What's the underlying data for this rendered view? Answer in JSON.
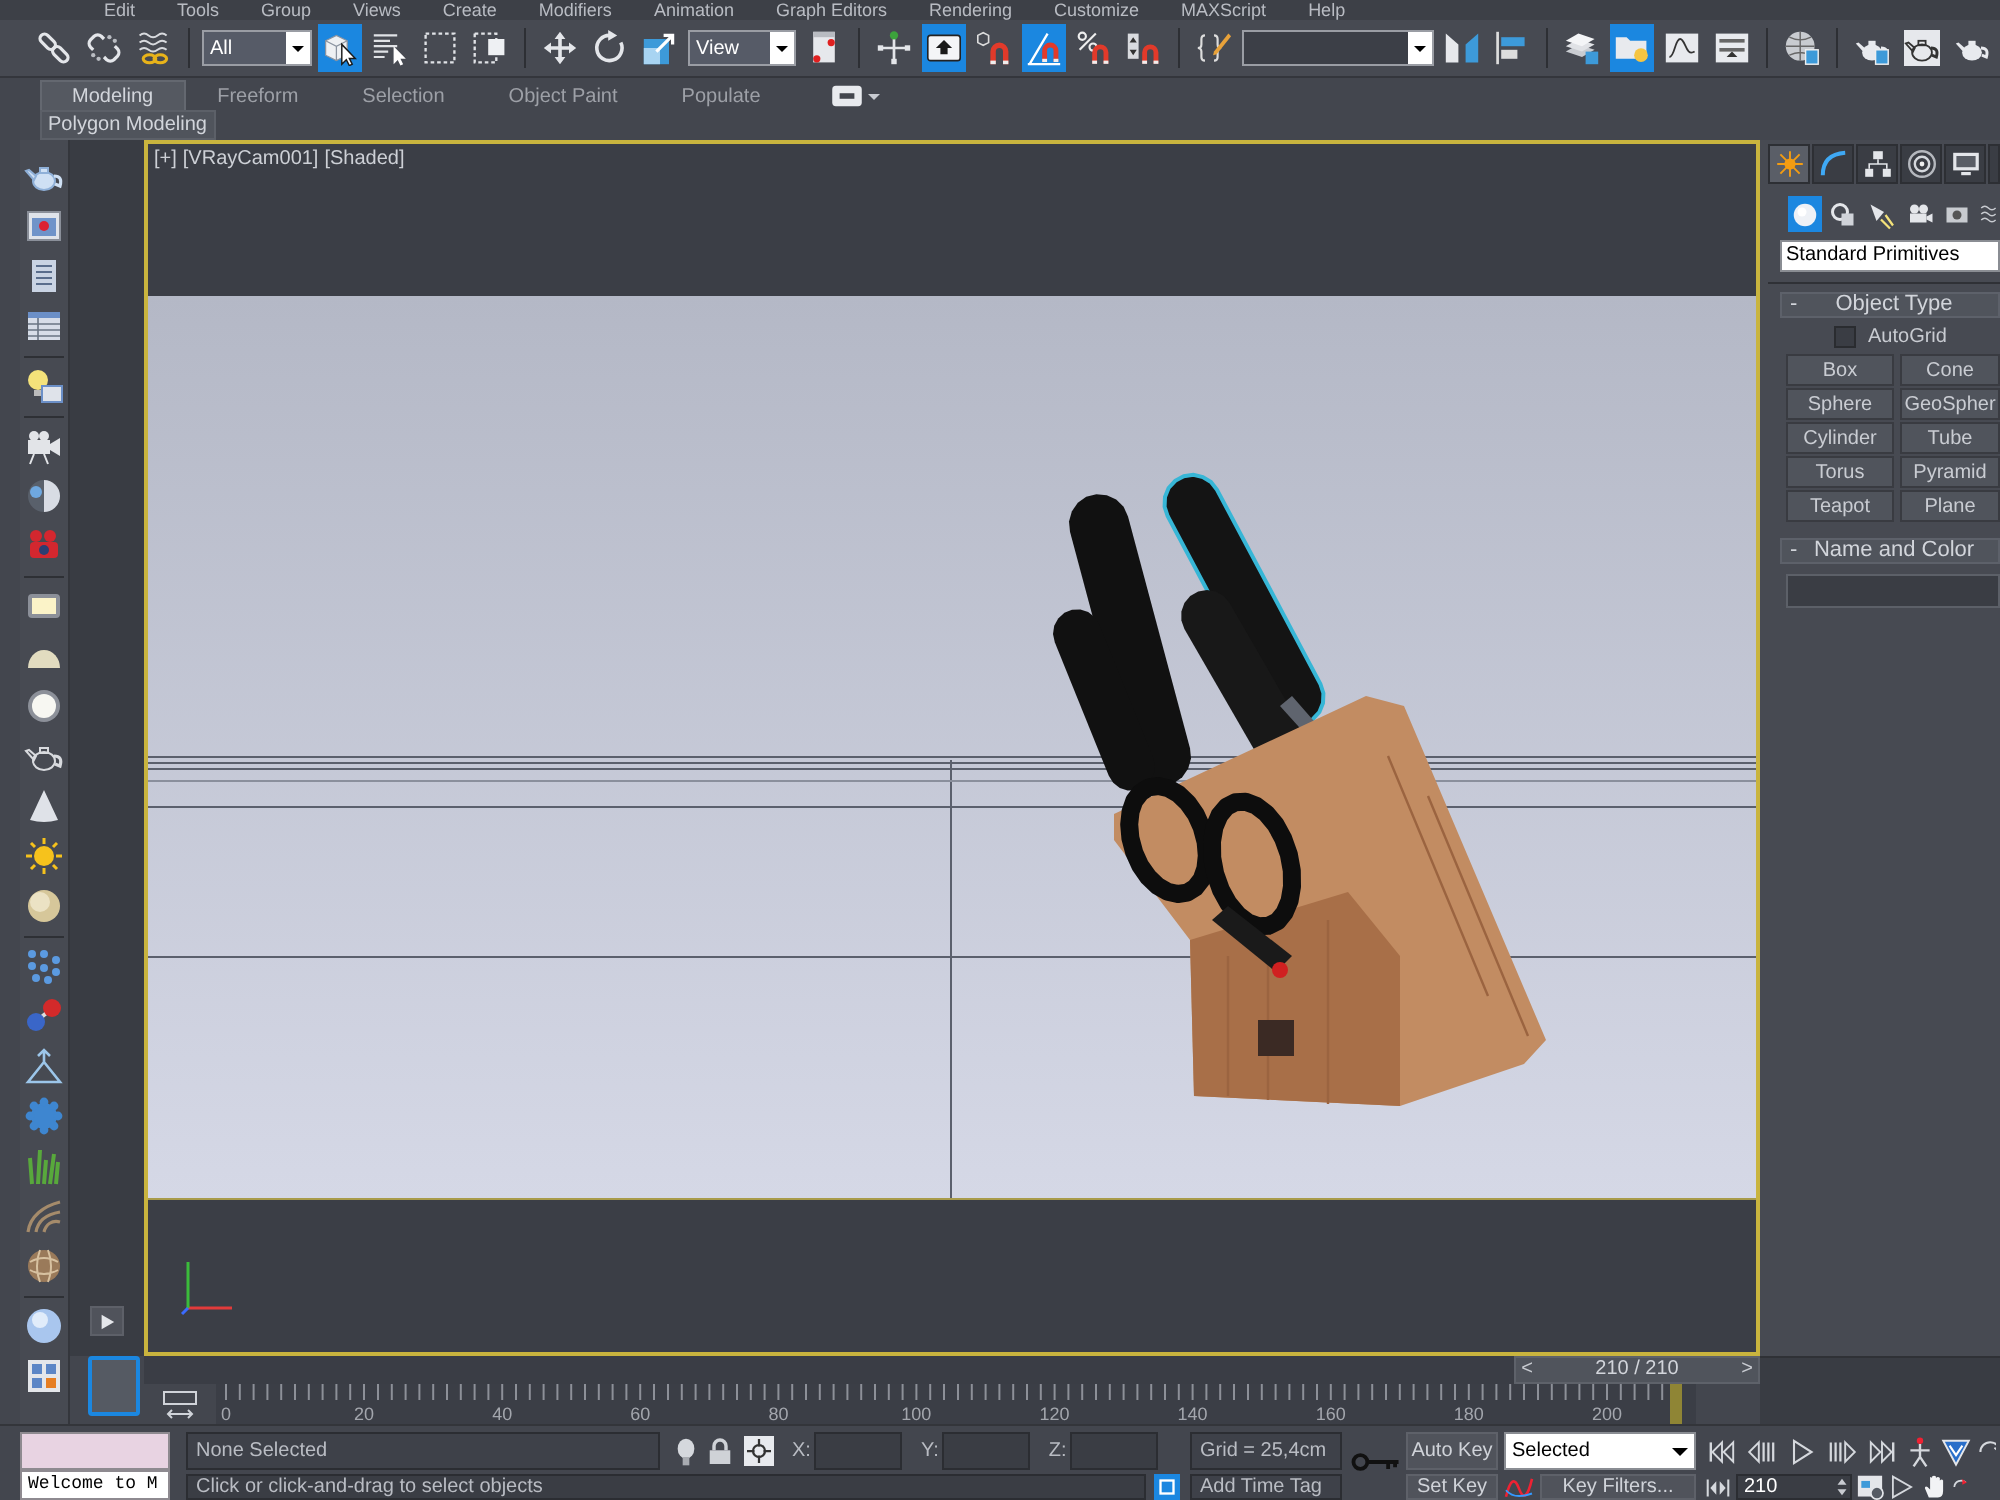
{
  "menu_bar": {
    "items": [
      "Edit",
      "Tools",
      "Group",
      "Views",
      "Create",
      "Modifiers",
      "Animation",
      "Graph Editors",
      "Rendering",
      "Customize",
      "MAXScript",
      "Help"
    ]
  },
  "main_toolbar": {
    "groups": [
      [
        {
          "kind": "tool",
          "pressed": false
        },
        {
          "kind": "tool",
          "pressed": false
        },
        {
          "kind": "tool",
          "pressed": false
        }
      ],
      [
        {
          "kind": "dropdown",
          "value": "All"
        },
        {
          "kind": "tool",
          "pressed": true
        },
        {
          "kind": "tool",
          "pressed": false
        },
        {
          "kind": "tool",
          "pressed": false
        },
        {
          "kind": "tool",
          "pressed": false
        }
      ],
      [
        {
          "kind": "tool",
          "pressed": false
        },
        {
          "kind": "tool",
          "pressed": false
        },
        {
          "kind": "tool",
          "pressed": false
        },
        {
          "kind": "dropdown",
          "value": "View"
        },
        {
          "kind": "tool",
          "pressed": false
        }
      ],
      [
        {
          "kind": "tool",
          "pressed": false
        },
        {
          "kind": "tool",
          "pressed": true
        },
        {
          "kind": "tool",
          "pressed": false
        },
        {
          "kind": "tool",
          "pressed": true
        },
        {
          "kind": "tool",
          "pressed": false
        },
        {
          "kind": "tool",
          "pressed": false
        }
      ],
      [
        {
          "kind": "tool",
          "pressed": false
        },
        {
          "kind": "dropdown"
        },
        {
          "kind": "tool",
          "pressed": false
        },
        {
          "kind": "tool",
          "pressed": false
        }
      ],
      [
        {
          "kind": "tool",
          "pressed": false
        },
        {
          "kind": "tool",
          "pressed": true
        },
        {
          "kind": "tool",
          "pressed": false
        },
        {
          "kind": "tool",
          "pressed": false
        }
      ],
      [
        {
          "kind": "tool",
          "pressed": false
        }
      ],
      [
        {
          "kind": "tool",
          "pressed": false
        },
        {
          "kind": "tool",
          "pressed": false
        },
        {
          "kind": "tool",
          "pressed": false
        }
      ]
    ]
  },
  "ribbon": {
    "tabs": [
      {
        "label": "Modeling",
        "selected": true
      },
      {
        "label": "Freeform",
        "selected": false
      },
      {
        "label": "Selection",
        "selected": false
      },
      {
        "label": "Object Paint",
        "selected": false
      },
      {
        "label": "Populate",
        "selected": false
      }
    ],
    "panel_label": "Polygon Modeling"
  },
  "viewport": {
    "active": true,
    "labels": [
      "[+]",
      "[VRayCam001]",
      "[Shaded]"
    ]
  },
  "command_panel": {
    "tabs": [
      {
        "selected": true
      },
      {
        "selected": false
      },
      {
        "selected": false
      },
      {
        "selected": false
      },
      {
        "selected": false
      },
      {
        "selected": false
      }
    ],
    "categories": [
      {
        "selected": true
      },
      {
        "selected": false
      },
      {
        "selected": false
      },
      {
        "selected": false
      },
      {
        "selected": false
      },
      {
        "selected": false
      }
    ],
    "dropdown": "Standard Primitives",
    "rollouts": [
      {
        "kind": "object_type",
        "toggle": "-",
        "title": "Object Type",
        "autogrid": {
          "label": "AutoGrid",
          "checked": false
        },
        "buttons": [
          "Box",
          "Cone",
          "Sphere",
          "GeoSpher",
          "Cylinder",
          "Tube",
          "Torus",
          "Pyramid",
          "Teapot",
          "Plane"
        ]
      },
      {
        "kind": "name_color",
        "toggle": "-",
        "title": "Name and Color"
      }
    ]
  },
  "time_slider": {
    "prev": "<",
    "label": "210 / 210",
    "next": ">",
    "level": 1
  },
  "track_bar": {
    "ticks": [
      "0",
      "20",
      "40",
      "60",
      "80",
      "100",
      "120",
      "140",
      "160",
      "180",
      "200"
    ]
  },
  "status_bar": {
    "listener_output": "Welcome to M",
    "selection": "None Selected",
    "prompt": "Click or click-and-drag to select objects",
    "coordinates": [
      {
        "label": "X:"
      },
      {
        "label": "Y:"
      },
      {
        "label": "Z:"
      }
    ],
    "grid": "Grid = 25,4cm",
    "time_tag": "Add Time Tag",
    "auto_key": {
      "label": "Auto Key",
      "on": false
    },
    "set_key": "Set Key",
    "key_mode": "Selected",
    "key_filters": "Key Filters...",
    "current_frame": "210"
  }
}
